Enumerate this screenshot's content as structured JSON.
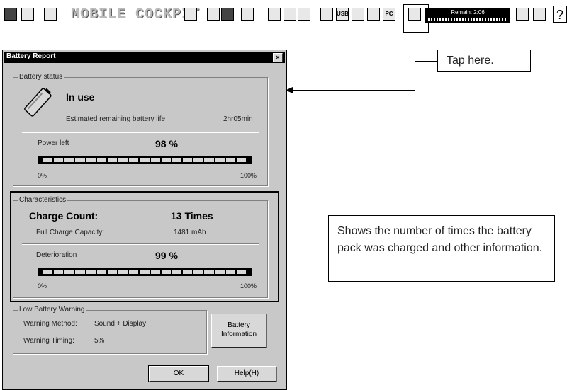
{
  "toolbar": {
    "title": "MOBILE COCKPIT",
    "remain_label": "Remain:  2:06",
    "help_glyph": "?",
    "icons": [
      "pc-card-icon",
      "pen-icon",
      "display-icon",
      "battery-icon",
      "battery-icon",
      "battery-icon",
      "brightness-icon",
      "network-icon",
      "volume-icon",
      "cd-icon",
      "usb-icon",
      "modem-icon",
      "wireless-icon",
      "pc-card-slot-icon",
      "battery-report-icon",
      "suspend-icon",
      "hibernate-icon"
    ],
    "usb_text": "USB",
    "pc_text": "PC"
  },
  "dialog": {
    "title": "Battery Report",
    "close_glyph": "×",
    "battery_status": {
      "group_label": "Battery status",
      "state": "In use",
      "remaining_label": "Estimated remaining battery life",
      "remaining_value": "2hr05min",
      "power_label": "Power left",
      "power_value": "98  %",
      "power_fraction": 0.98,
      "scale_min": "0%",
      "scale_max": "100%"
    },
    "characteristics": {
      "group_label": "Characteristics",
      "charge_count_label": "Charge Count:",
      "charge_count_value": "13  Times",
      "capacity_label": "Full Charge Capacity:",
      "capacity_value": "1481 mAh",
      "deterioration_label": "Deterioration",
      "deterioration_value": "99  %",
      "deterioration_fraction": 0.99,
      "scale_min": "0%",
      "scale_max": "100%"
    },
    "low_battery": {
      "group_label": "Low Battery Warning",
      "method_label": "Warning Method:",
      "method_value": "Sound + Display",
      "timing_label": "Warning Timing:",
      "timing_value": "5%",
      "info_button_line1": "Battery",
      "info_button_line2": "Information"
    },
    "ok_label": "OK",
    "help_label": "Help(H)"
  },
  "callouts": {
    "tap_here": "Tap here.",
    "shows_number": "Shows the number of times the battery pack was charged and other information."
  }
}
